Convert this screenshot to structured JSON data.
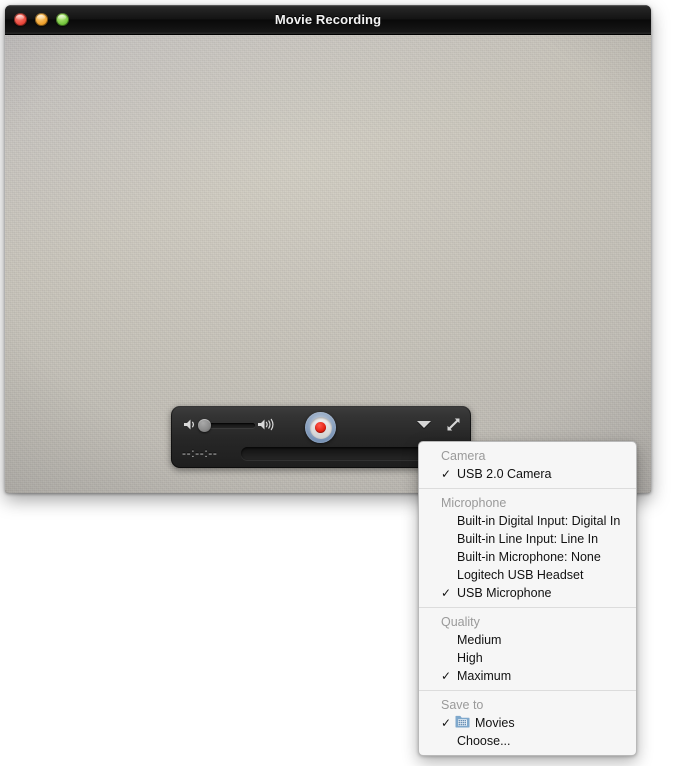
{
  "window": {
    "title": "Movie Recording",
    "traffic_lights": [
      {
        "name": "close",
        "color": "#e8463a"
      },
      {
        "name": "minimize",
        "color": "#eea02c"
      },
      {
        "name": "zoom",
        "color": "#73c43c"
      }
    ]
  },
  "controls": {
    "volume_low_icon": "speaker-low-icon",
    "volume_high_icon": "speaker-high-icon",
    "volume_value": 18,
    "record_button_label": "Record",
    "record_accent": "#e01c0c",
    "options_chevron_icon": "chevron-down-icon",
    "fullscreen_icon": "expand-arrows-icon",
    "timecode": "--:--:--",
    "scrub_position": 0
  },
  "menu": {
    "sections": [
      {
        "title": "Camera",
        "items": [
          {
            "label": "USB 2.0 Camera",
            "checked": true
          }
        ]
      },
      {
        "title": "Microphone",
        "items": [
          {
            "label": "Built-in Digital Input: Digital In",
            "checked": false
          },
          {
            "label": "Built-in Line Input: Line In",
            "checked": false
          },
          {
            "label": "Built-in Microphone: None",
            "checked": false
          },
          {
            "label": "Logitech USB Headset",
            "checked": false
          },
          {
            "label": "USB Microphone",
            "checked": true
          }
        ]
      },
      {
        "title": "Quality",
        "items": [
          {
            "label": "Medium",
            "checked": false
          },
          {
            "label": "High",
            "checked": false
          },
          {
            "label": "Maximum",
            "checked": true
          }
        ]
      },
      {
        "title": "Save to",
        "items": [
          {
            "label": "Movies",
            "checked": true,
            "icon": "movies-folder-icon"
          },
          {
            "label": "Choose...",
            "checked": false
          }
        ]
      }
    ],
    "checkmark_glyph": "✓"
  }
}
